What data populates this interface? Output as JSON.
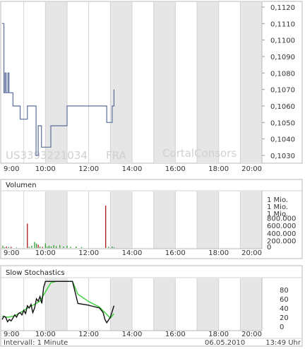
{
  "chart_data": [
    {
      "type": "line",
      "x_ticks": [
        "9:00",
        "10:00",
        "12:00",
        "14:00",
        "16:00",
        "18:00",
        "20:00"
      ],
      "y_ticks": [
        "0,1030",
        "0,1040",
        "0,1050",
        "0,1060",
        "0,1070",
        "0,1080",
        "0,1090",
        "0,1100",
        "0,1110",
        "0,1120"
      ],
      "ylim": [
        0.1025,
        0.1124
      ],
      "watermark_symbol": "US3393221034",
      "watermark_exchange": "FRA",
      "watermark_brand": "CortalConsors",
      "series": [
        {
          "x": [
            "08:00",
            "08:04",
            "08:05",
            "08:07",
            "08:08",
            "08:10",
            "08:11",
            "08:13",
            "08:16",
            "08:18",
            "08:19",
            "08:22",
            "08:30",
            "08:50",
            "09:05",
            "09:10",
            "09:11",
            "09:17",
            "09:18",
            "09:23",
            "09:25",
            "09:29",
            "09:30",
            "09:34",
            "09:35",
            "09:40",
            "09:42",
            "09:49",
            "09:50",
            "10:15",
            "11:00",
            "12:00",
            "12:30",
            "12:47",
            "12:50",
            "13:00",
            "13:02",
            "13:05",
            "13:06",
            "13:10"
          ],
          "values": [
            0.111,
            0.111,
            0.1068,
            0.1068,
            0.108,
            0.108,
            0.1068,
            0.1068,
            0.108,
            0.108,
            0.1068,
            0.1068,
            0.106,
            0.1052,
            0.1052,
            0.106,
            0.106,
            0.106,
            0.106,
            0.106,
            0.106,
            0.106,
            0.106,
            0.103,
            0.103,
            0.1048,
            0.1048,
            0.1035,
            0.1035,
            0.1048,
            0.106,
            0.106,
            0.106,
            0.106,
            0.105,
            0.105,
            0.105,
            0.106,
            0.106,
            0.107
          ],
          "color": "#5a6f9a"
        }
      ]
    },
    {
      "type": "bar",
      "title": "Volumen",
      "y_ticks": [
        "0",
        "200.000",
        "400.000",
        "600.000",
        "800.000",
        "1 Mio.",
        "1 Mio.",
        "1 Mio."
      ],
      "ylim": [
        0,
        1450000
      ],
      "up_color": "#2d9c2d",
      "down_color": "#b01515",
      "bars": [
        {
          "x": "08:02",
          "value": 60000,
          "dir": "up"
        },
        {
          "x": "08:07",
          "value": 20000,
          "dir": "up"
        },
        {
          "x": "08:12",
          "value": 40000,
          "dir": "down"
        },
        {
          "x": "08:18",
          "value": 25000,
          "dir": "up"
        },
        {
          "x": "08:25",
          "value": 30000,
          "dir": "down"
        },
        {
          "x": "08:40",
          "value": 15000,
          "dir": "up"
        },
        {
          "x": "09:10",
          "value": 650000,
          "dir": "down"
        },
        {
          "x": "09:15",
          "value": 30000,
          "dir": "up"
        },
        {
          "x": "09:22",
          "value": 60000,
          "dir": "up"
        },
        {
          "x": "09:30",
          "value": 160000,
          "dir": "up"
        },
        {
          "x": "09:35",
          "value": 120000,
          "dir": "up"
        },
        {
          "x": "09:40",
          "value": 90000,
          "dir": "down"
        },
        {
          "x": "09:45",
          "value": 40000,
          "dir": "up"
        },
        {
          "x": "09:52",
          "value": 30000,
          "dir": "down"
        },
        {
          "x": "10:00",
          "value": 120000,
          "dir": "up"
        },
        {
          "x": "10:05",
          "value": 30000,
          "dir": "up"
        },
        {
          "x": "10:10",
          "value": 60000,
          "dir": "up"
        },
        {
          "x": "10:16",
          "value": 40000,
          "dir": "up"
        },
        {
          "x": "10:23",
          "value": 80000,
          "dir": "up"
        },
        {
          "x": "10:30",
          "value": 50000,
          "dir": "up"
        },
        {
          "x": "10:40",
          "value": 80000,
          "dir": "up"
        },
        {
          "x": "10:50",
          "value": 40000,
          "dir": "up"
        },
        {
          "x": "11:00",
          "value": 60000,
          "dir": "up"
        },
        {
          "x": "11:10",
          "value": 30000,
          "dir": "up"
        },
        {
          "x": "11:25",
          "value": 40000,
          "dir": "up"
        },
        {
          "x": "11:40",
          "value": 25000,
          "dir": "up"
        },
        {
          "x": "12:47",
          "value": 1130000,
          "dir": "down"
        },
        {
          "x": "12:55",
          "value": 30000,
          "dir": "up"
        },
        {
          "x": "13:05",
          "value": 40000,
          "dir": "up"
        },
        {
          "x": "13:10",
          "value": 20000,
          "dir": "up"
        }
      ]
    },
    {
      "type": "line",
      "title": "Slow Stochastics",
      "y_ticks": [
        "0",
        "20",
        "40",
        "60",
        "80"
      ],
      "ylim": [
        0,
        100
      ],
      "series": [
        {
          "color": "#111111",
          "x": [
            "08:00",
            "08:05",
            "08:10",
            "08:15",
            "08:20",
            "08:25",
            "08:30",
            "08:35",
            "08:40",
            "08:45",
            "08:50",
            "08:55",
            "09:00",
            "09:05",
            "09:10",
            "09:15",
            "09:20",
            "09:25",
            "09:30",
            "09:35",
            "09:40",
            "09:45",
            "09:50",
            "09:55",
            "10:00",
            "10:10",
            "10:20",
            "10:30",
            "10:45",
            "11:00",
            "11:15",
            "11:30",
            "12:00",
            "12:30",
            "12:40",
            "12:45",
            "12:50",
            "13:00",
            "13:10"
          ],
          "values": [
            15,
            22,
            20,
            10,
            15,
            12,
            18,
            25,
            20,
            28,
            30,
            25,
            35,
            28,
            45,
            40,
            48,
            30,
            40,
            60,
            55,
            65,
            50,
            85,
            98,
            98,
            98,
            98,
            98,
            98,
            98,
            50,
            46,
            40,
            30,
            15,
            8,
            20,
            45
          ]
        },
        {
          "color": "#3ad33a",
          "x": [
            "08:00",
            "08:15",
            "08:30",
            "08:45",
            "09:00",
            "09:15",
            "09:30",
            "09:45",
            "10:00",
            "10:15",
            "10:30",
            "10:45",
            "11:00",
            "11:15",
            "11:30",
            "12:00",
            "12:30",
            "12:45",
            "13:00",
            "13:10"
          ],
          "values": [
            22,
            20,
            22,
            27,
            35,
            42,
            48,
            55,
            75,
            95,
            98,
            98,
            98,
            98,
            70,
            54,
            42,
            30,
            18,
            28
          ]
        }
      ]
    }
  ],
  "footer": {
    "interval_label": "Intervall: 1 Minute",
    "date": "06.05.2010",
    "time": "13:49 Uhr"
  }
}
